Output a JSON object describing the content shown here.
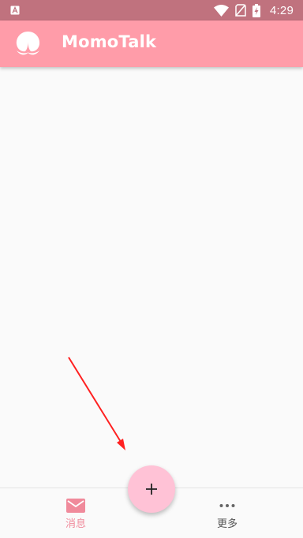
{
  "status_bar": {
    "time": "4:29",
    "icons": [
      "notification-a-icon",
      "wifi-icon",
      "no-signal-icon",
      "battery-charging-icon"
    ]
  },
  "app_bar": {
    "title": "MomoTalk",
    "logo": "peach-icon",
    "color": "#ff9ca9"
  },
  "fab": {
    "icon": "plus-icon",
    "color": "#ffc2d6"
  },
  "bottom_nav": {
    "items": [
      {
        "label": "消息",
        "icon": "mail-icon",
        "active": true,
        "color": "#f08a9b"
      },
      {
        "label": "更多",
        "icon": "more-dots-icon",
        "active": false,
        "color": "#555555"
      }
    ]
  },
  "annotation": {
    "type": "arrow",
    "color": "#ff2020",
    "target": "fab"
  }
}
